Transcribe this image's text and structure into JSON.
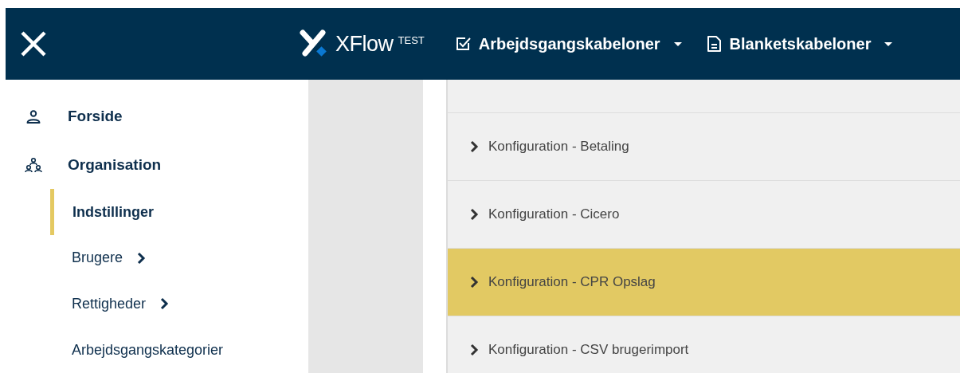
{
  "header": {
    "logo": {
      "name": "XFlow",
      "badge": "TEST"
    },
    "menus": [
      {
        "label": "Arbejdsgangskabeloner"
      },
      {
        "label": "Blanketskabeloner"
      }
    ]
  },
  "sidebar": {
    "items": [
      {
        "label": "Forside",
        "kind": "section"
      },
      {
        "label": "Organisation",
        "kind": "section"
      },
      {
        "label": "Indstillinger",
        "kind": "sub",
        "selected": true,
        "has_children": false
      },
      {
        "label": "Brugere",
        "kind": "sub",
        "selected": false,
        "has_children": true
      },
      {
        "label": "Rettigheder",
        "kind": "sub",
        "selected": false,
        "has_children": true
      },
      {
        "label": "Arbejdsgangskategorier",
        "kind": "sub",
        "selected": false,
        "has_children": false
      }
    ]
  },
  "settings": [
    {
      "label": "Konfiguration - Betaling",
      "selected": false
    },
    {
      "label": "Konfiguration - Cicero",
      "selected": false
    },
    {
      "label": "Konfiguration - CPR Opslag",
      "selected": true
    },
    {
      "label": "Konfiguration - CSV brugerimport",
      "selected": false
    }
  ]
}
